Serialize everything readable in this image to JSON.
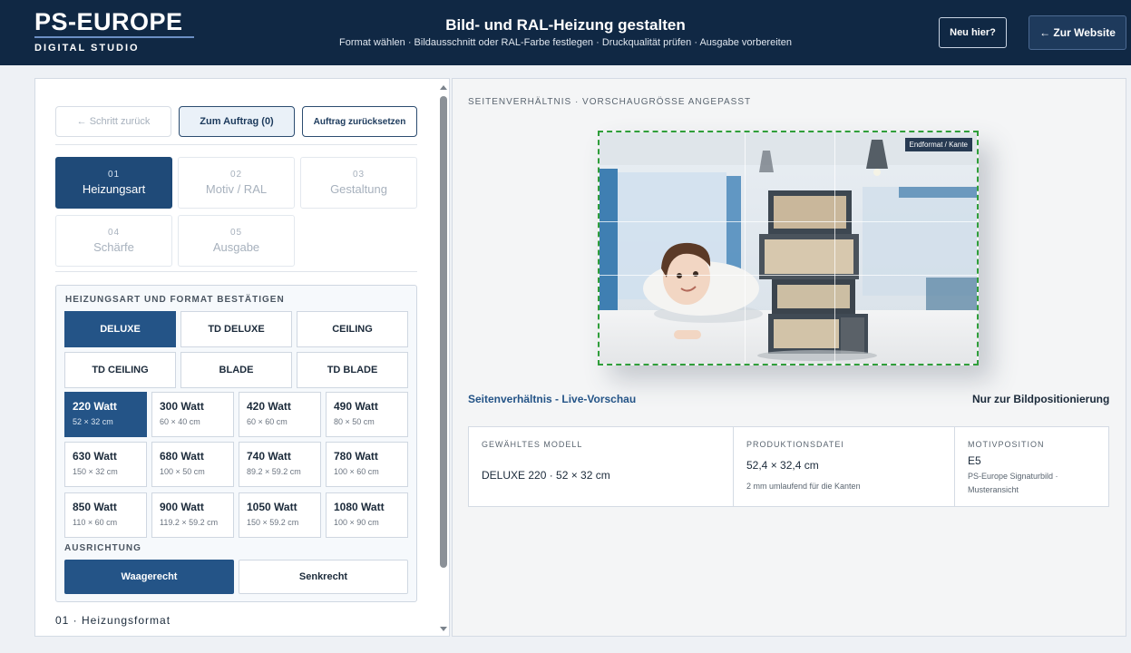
{
  "header": {
    "logo_main": "PS-EUROPE",
    "logo_sub": "DIGITAL STUDIO",
    "title": "Bild- und RAL-Heizung gestalten",
    "subtitle": "Format wählen · Bildausschnitt oder RAL-Farbe festlegen · Druckqualität prüfen · Ausgabe vorbereiten",
    "new_here_label": "Neu hier?",
    "website_label": "← Zur Website"
  },
  "toolbar": {
    "back_label": "← Schritt zurück",
    "order_label": "Zum Auftrag (0)",
    "reset_label": "Auftrag zurücksetzen"
  },
  "steps": [
    {
      "num": "01",
      "label": "Heizungsart"
    },
    {
      "num": "02",
      "label": "Motiv / RAL"
    },
    {
      "num": "03",
      "label": "Gestaltung"
    },
    {
      "num": "04",
      "label": "Schärfe"
    },
    {
      "num": "05",
      "label": "Ausgabe"
    }
  ],
  "heating": {
    "section_label": "HEIZUNGSART UND FORMAT BESTÄTIGEN",
    "types": [
      "DELUXE",
      "TD DELUXE",
      "CEILING",
      "TD CEILING",
      "BLADE",
      "TD BLADE"
    ],
    "watts": [
      {
        "w": "220 Watt",
        "s": "52 × 32 cm"
      },
      {
        "w": "300 Watt",
        "s": "60 × 40 cm"
      },
      {
        "w": "420 Watt",
        "s": "60 × 60 cm"
      },
      {
        "w": "490 Watt",
        "s": "80 × 50 cm"
      },
      {
        "w": "630 Watt",
        "s": "150 × 32 cm"
      },
      {
        "w": "680 Watt",
        "s": "100 × 50 cm"
      },
      {
        "w": "740 Watt",
        "s": "89.2 × 59.2 cm"
      },
      {
        "w": "780 Watt",
        "s": "100 × 60 cm"
      },
      {
        "w": "850 Watt",
        "s": "110 × 60 cm"
      },
      {
        "w": "900 Watt",
        "s": "119.2 × 59.2 cm"
      },
      {
        "w": "1050 Watt",
        "s": "150 × 59.2 cm"
      },
      {
        "w": "1080 Watt",
        "s": "100 × 90 cm"
      }
    ],
    "orientation_label": "AUSRICHTUNG",
    "orientation_h": "Waagerecht",
    "orientation_v": "Senkrecht",
    "footer_label": "01 · Heizungsformat"
  },
  "preview": {
    "section_label": "SEITENVERHÄLTNIS · VORSCHAUGRÖSSE ANGEPASST",
    "endformat_label": "Endformat / Kante",
    "live_label": "Seitenverhältnis - Live-Vorschau",
    "note_label": "Nur zur Bildpositionierung"
  },
  "info": {
    "model_head": "GEWÄHLTES MODELL",
    "model_value": "DELUXE 220 · 52 × 32 cm",
    "file_head": "PRODUKTIONSDATEI",
    "file_value": "52,4 × 32,4 cm",
    "file_note": "2 mm umlaufend für die Kanten",
    "motif_head": "MOTIVPOSITION",
    "motif_value": "E5",
    "motif_note_1": "PS-Europe Signaturbild ·",
    "motif_note_2": "Musteransicht"
  },
  "colors": {
    "header_bg": "#102844",
    "accent": "#245487",
    "guide_green": "#2f9e3a"
  }
}
